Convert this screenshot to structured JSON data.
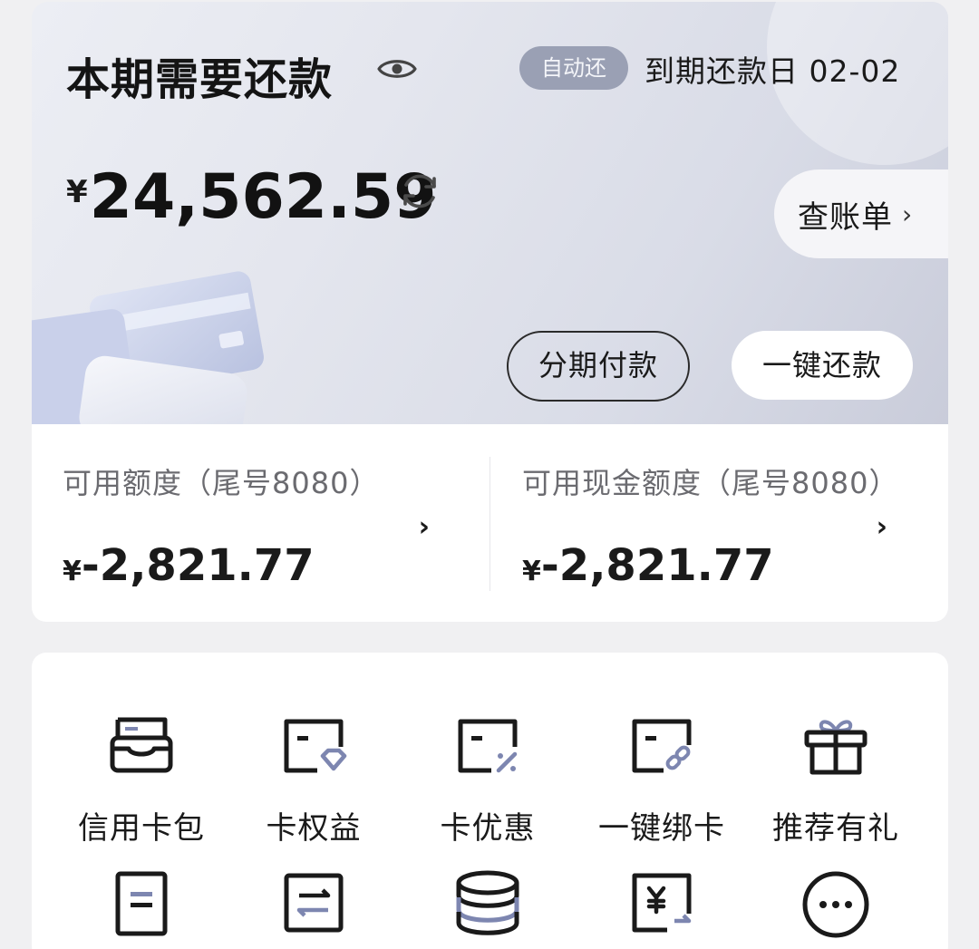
{
  "bill": {
    "title": "本期需要还款",
    "auto_badge": "自动还",
    "due_date_label": "到期还款日 02-02",
    "currency": "¥",
    "amount": "24,562.59",
    "view_bill_label": "查账单",
    "installment_label": "分期付款",
    "one_click_repay_label": "一键还款"
  },
  "credit": {
    "left": {
      "label": "可用额度（尾号8080）",
      "currency": "¥",
      "amount": "-2,821.77"
    },
    "right": {
      "label": "可用现金额度（尾号8080）",
      "currency": "¥",
      "amount": "-2,821.77"
    }
  },
  "menu": {
    "row1": [
      {
        "label": "信用卡包",
        "icon": "card-wallet-icon"
      },
      {
        "label": "卡权益",
        "icon": "card-benefits-icon"
      },
      {
        "label": "卡优惠",
        "icon": "card-discount-icon"
      },
      {
        "label": "一键绑卡",
        "icon": "card-bind-icon"
      },
      {
        "label": "推荐有礼",
        "icon": "gift-icon"
      }
    ],
    "row2": [
      {
        "icon": "document-icon"
      },
      {
        "icon": "transfer-icon"
      },
      {
        "icon": "coin-stack-icon"
      },
      {
        "icon": "yuan-screen-icon"
      },
      {
        "icon": "more-icon"
      }
    ]
  },
  "colors": {
    "accent_badge": "#9aa0b4",
    "text_primary": "#1a1a1a",
    "text_secondary": "#6b6b70",
    "icon_accent": "#7d86b0"
  }
}
